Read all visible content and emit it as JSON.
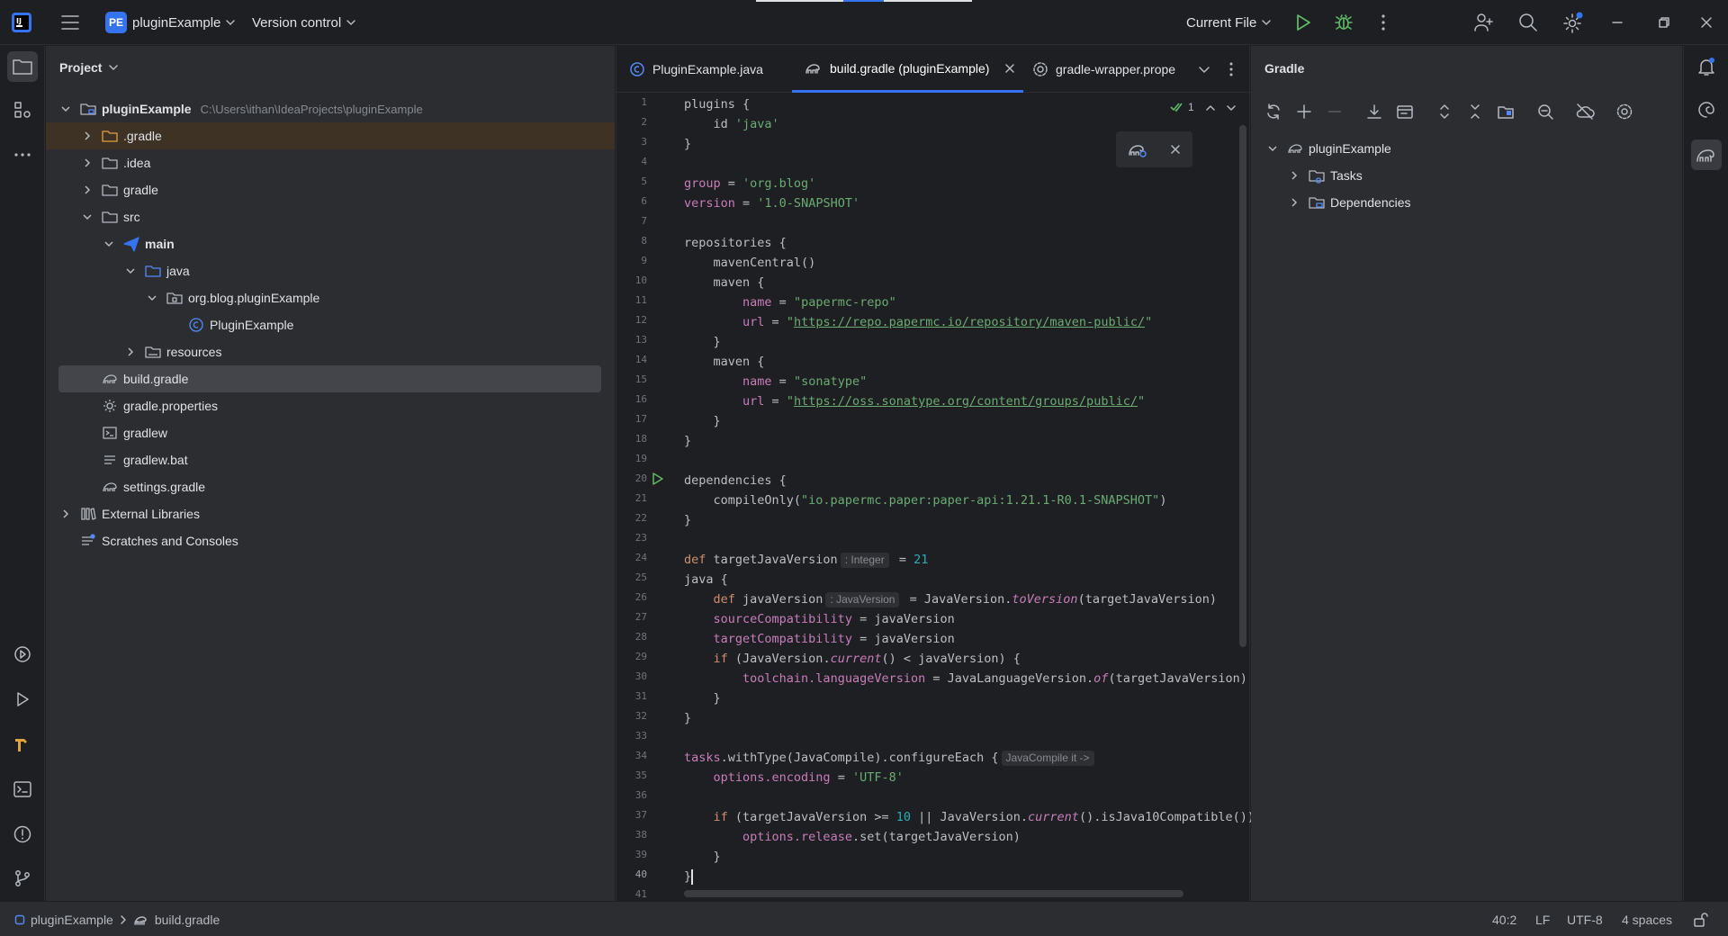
{
  "titlebar": {
    "project_badge": "PE",
    "project_name": "pluginExample",
    "vcs_label": "Version control",
    "run_config": "Current File"
  },
  "project_panel": {
    "title": "Project",
    "tree": [
      {
        "label": "pluginExample",
        "path": "C:\\Users\\ithan\\IdeaProjects\\pluginExample",
        "depth": 0,
        "expanded": true,
        "icon": "module-folder-icon",
        "bold": true
      },
      {
        "label": ".gradle",
        "depth": 1,
        "expanded": false,
        "icon": "folder-orange-icon"
      },
      {
        "label": ".idea",
        "depth": 1,
        "expanded": false,
        "icon": "folder-icon"
      },
      {
        "label": "gradle",
        "depth": 1,
        "expanded": false,
        "icon": "folder-icon"
      },
      {
        "label": "src",
        "depth": 1,
        "expanded": true,
        "icon": "folder-icon"
      },
      {
        "label": "main",
        "depth": 2,
        "expanded": true,
        "icon": "paper-plane-icon",
        "bold": true
      },
      {
        "label": "java",
        "depth": 3,
        "expanded": true,
        "icon": "source-folder-icon"
      },
      {
        "label": "org.blog.pluginExample",
        "depth": 4,
        "expanded": true,
        "icon": "package-icon"
      },
      {
        "label": "PluginExample",
        "depth": 5,
        "icon": "java-class-icon"
      },
      {
        "label": "resources",
        "depth": 3,
        "expanded": false,
        "icon": "resources-folder-icon"
      },
      {
        "label": "build.gradle",
        "depth": 1,
        "icon": "gradle-icon",
        "selected": true
      },
      {
        "label": "gradle.properties",
        "depth": 1,
        "icon": "settings-file-icon"
      },
      {
        "label": "gradlew",
        "depth": 1,
        "icon": "terminal-file-icon"
      },
      {
        "label": "gradlew.bat",
        "depth": 1,
        "icon": "text-file-icon"
      },
      {
        "label": "settings.gradle",
        "depth": 1,
        "icon": "gradle-icon"
      },
      {
        "label": "External Libraries",
        "depth": 0,
        "expanded": false,
        "icon": "library-icon"
      },
      {
        "label": "Scratches and Consoles",
        "depth": 0,
        "icon": "scratches-icon"
      }
    ]
  },
  "editor": {
    "tabs": [
      {
        "label": "PluginExample.java",
        "icon": "java-class-icon",
        "active": false
      },
      {
        "label": "build.gradle (pluginExample)",
        "icon": "gradle-icon",
        "active": true
      },
      {
        "label": "gradle-wrapper.prope",
        "icon": "settings-file-icon",
        "active": false
      }
    ],
    "inspection_count": "1",
    "current_line": 40,
    "line_numbers": [
      "1",
      "2",
      "3",
      "4",
      "5",
      "6",
      "7",
      "8",
      "9",
      "10",
      "11",
      "12",
      "13",
      "14",
      "15",
      "16",
      "17",
      "18",
      "19",
      "20",
      "21",
      "22",
      "23",
      "24",
      "25",
      "26",
      "27",
      "28",
      "29",
      "30",
      "31",
      "32",
      "33",
      "34",
      "35",
      "36",
      "37",
      "38",
      "39",
      "40",
      "41"
    ],
    "code": [
      [
        {
          "t": "plugins {"
        }
      ],
      [
        {
          "t": "    id "
        },
        {
          "t": "'java'",
          "c": "str"
        }
      ],
      [
        {
          "t": "}"
        }
      ],
      [],
      [
        {
          "t": "group",
          "c": "prop"
        },
        {
          "t": " = "
        },
        {
          "t": "'org.blog'",
          "c": "str"
        }
      ],
      [
        {
          "t": "version",
          "c": "prop"
        },
        {
          "t": " = "
        },
        {
          "t": "'1.0-SNAPSHOT'",
          "c": "str"
        }
      ],
      [],
      [
        {
          "t": "repositories {"
        }
      ],
      [
        {
          "t": "    mavenCentral()"
        }
      ],
      [
        {
          "t": "    maven {"
        }
      ],
      [
        {
          "t": "        "
        },
        {
          "t": "name",
          "c": "prop"
        },
        {
          "t": " = "
        },
        {
          "t": "\"papermc-repo\"",
          "c": "str"
        }
      ],
      [
        {
          "t": "        "
        },
        {
          "t": "url",
          "c": "prop"
        },
        {
          "t": " = "
        },
        {
          "t": "\"",
          "c": "str"
        },
        {
          "t": "https://repo.papermc.io/repository/maven-public/",
          "c": "url"
        },
        {
          "t": "\"",
          "c": "str"
        }
      ],
      [
        {
          "t": "    }"
        }
      ],
      [
        {
          "t": "    maven {"
        }
      ],
      [
        {
          "t": "        "
        },
        {
          "t": "name",
          "c": "prop"
        },
        {
          "t": " = "
        },
        {
          "t": "\"sonatype\"",
          "c": "str"
        }
      ],
      [
        {
          "t": "        "
        },
        {
          "t": "url",
          "c": "prop"
        },
        {
          "t": " = "
        },
        {
          "t": "\"",
          "c": "str"
        },
        {
          "t": "https://oss.sonatype.org/content/groups/public/",
          "c": "url"
        },
        {
          "t": "\"",
          "c": "str"
        }
      ],
      [
        {
          "t": "    }"
        }
      ],
      [
        {
          "t": "}"
        }
      ],
      [],
      [
        {
          "t": "dependencies {"
        }
      ],
      [
        {
          "t": "    compileOnly("
        },
        {
          "t": "\"io.papermc.paper:paper-api:1.21.1-R0.1-SNAPSHOT\"",
          "c": "str"
        },
        {
          "t": ")"
        }
      ],
      [
        {
          "t": "}"
        }
      ],
      [],
      [
        {
          "t": "def ",
          "c": "kw"
        },
        {
          "t": "targetJavaVersion"
        },
        {
          "t": ": Integer",
          "c": "hint"
        },
        {
          "t": " = "
        },
        {
          "t": "21",
          "c": "num"
        }
      ],
      [
        {
          "t": "java {"
        }
      ],
      [
        {
          "t": "    "
        },
        {
          "t": "def ",
          "c": "kw"
        },
        {
          "t": "javaVersion"
        },
        {
          "t": ": JavaVersion",
          "c": "hint"
        },
        {
          "t": " = JavaVersion."
        },
        {
          "t": "toVersion",
          "c": "ital"
        },
        {
          "t": "(targetJavaVersion)"
        }
      ],
      [
        {
          "t": "    "
        },
        {
          "t": "sourceCompatibility",
          "c": "prop"
        },
        {
          "t": " = javaVersion"
        }
      ],
      [
        {
          "t": "    "
        },
        {
          "t": "targetCompatibility",
          "c": "prop"
        },
        {
          "t": " = javaVersion"
        }
      ],
      [
        {
          "t": "    "
        },
        {
          "t": "if ",
          "c": "kw"
        },
        {
          "t": "(JavaVersion."
        },
        {
          "t": "current",
          "c": "ital"
        },
        {
          "t": "() < javaVersion) {"
        }
      ],
      [
        {
          "t": "        "
        },
        {
          "t": "toolchain.languageVersion",
          "c": "prop"
        },
        {
          "t": " = JavaLanguageVersion."
        },
        {
          "t": "of",
          "c": "ital"
        },
        {
          "t": "(targetJavaVersion)"
        }
      ],
      [
        {
          "t": "    }"
        }
      ],
      [
        {
          "t": "}"
        }
      ],
      [],
      [
        {
          "t": "tasks",
          "c": "prop"
        },
        {
          "t": ".withType(JavaCompile).configureEach "
        },
        {
          "t": "{"
        },
        {
          "t": "JavaCompile it ->",
          "c": "hint"
        }
      ],
      [
        {
          "t": "    "
        },
        {
          "t": "options.encoding",
          "c": "prop"
        },
        {
          "t": " = "
        },
        {
          "t": "'UTF-8'",
          "c": "str"
        }
      ],
      [],
      [
        {
          "t": "    "
        },
        {
          "t": "if ",
          "c": "kw"
        },
        {
          "t": "(targetJavaVersion >= "
        },
        {
          "t": "10",
          "c": "num"
        },
        {
          "t": " || JavaVersion."
        },
        {
          "t": "current",
          "c": "ital"
        },
        {
          "t": "().isJava10Compatible())"
        }
      ],
      [
        {
          "t": "        "
        },
        {
          "t": "options.release",
          "c": "prop"
        },
        {
          "t": ".set(targetJavaVersion)"
        }
      ],
      [
        {
          "t": "    }"
        }
      ],
      [
        {
          "t": "}"
        },
        {
          "caret": true
        }
      ],
      []
    ]
  },
  "gradle_panel": {
    "title": "Gradle",
    "tree": [
      {
        "label": "pluginExample",
        "depth": 0,
        "expanded": true,
        "icon": "gradle-icon"
      },
      {
        "label": "Tasks",
        "depth": 1,
        "expanded": false,
        "icon": "tasks-folder-icon"
      },
      {
        "label": "Dependencies",
        "depth": 1,
        "expanded": false,
        "icon": "dependencies-folder-icon"
      }
    ]
  },
  "statusbar": {
    "breadcrumb_project": "pluginExample",
    "breadcrumb_file": "build.gradle",
    "position": "40:2",
    "line_separator": "LF",
    "encoding": "UTF-8",
    "indent": "4 spaces"
  },
  "colors": {
    "accent": "#3574f0",
    "bg_dark": "#1e1f22",
    "bg_panel": "#2b2d30",
    "run_green": "#5fb865"
  }
}
